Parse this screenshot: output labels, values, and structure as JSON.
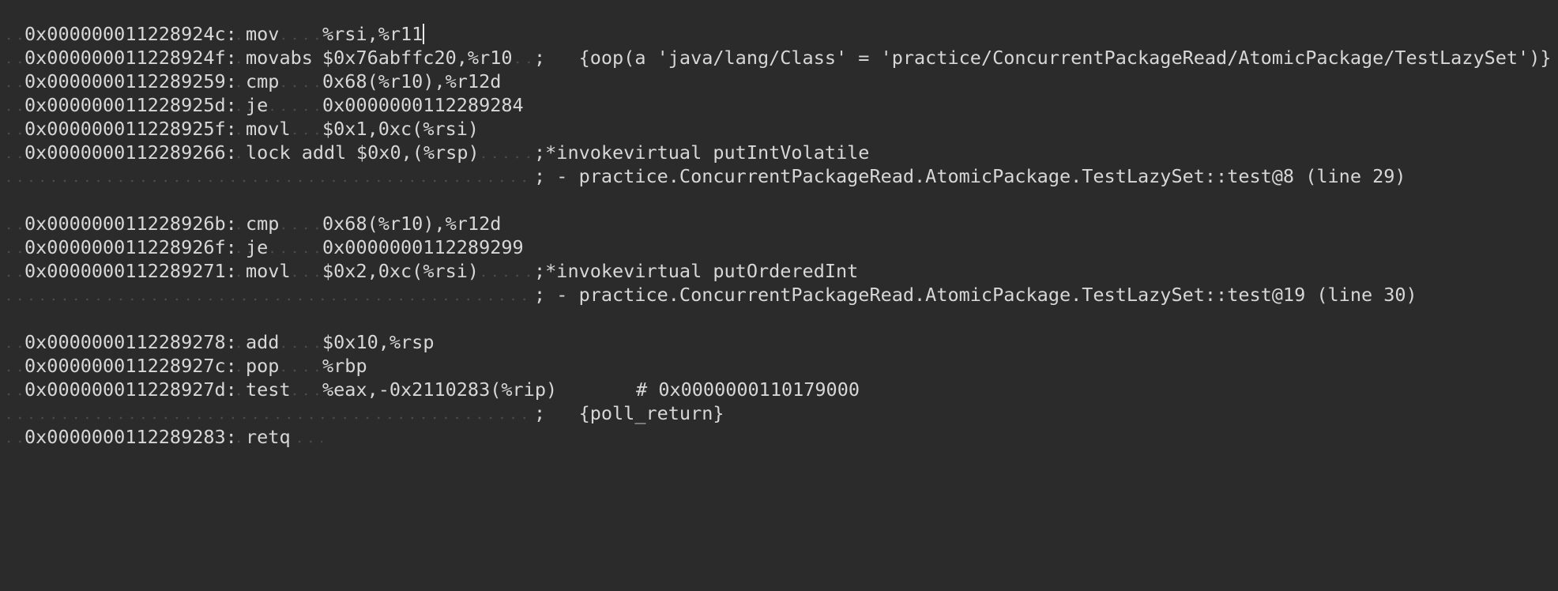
{
  "editor": {
    "colors": {
      "background": "#2b2b2b",
      "text": "#d7d7d7",
      "whitespace_marker": "#5a5a5a",
      "caret": "#e8e8e8"
    },
    "lines": [
      {
        "addr": "0x000000011228924c:",
        "op": "mov",
        "args": "%rsi,%r11",
        "comment": ""
      },
      {
        "addr": "0x000000011228924f:",
        "op": "movabs",
        "args": "$0x76abffc20,%r10",
        "comment": ";   {oop(a 'java/lang/Class' = 'practice/ConcurrentPackageRead/AtomicPackage/TestLazySet')}"
      },
      {
        "addr": "0x0000000112289259:",
        "op": "cmp",
        "args": "0x68(%r10),%r12d",
        "comment": ""
      },
      {
        "addr": "0x000000011228925d:",
        "op": "je",
        "args": "0x0000000112289284",
        "comment": ""
      },
      {
        "addr": "0x000000011228925f:",
        "op": "movl",
        "args": "$0x1,0xc(%rsi)",
        "comment": ""
      },
      {
        "addr": "0x0000000112289266:",
        "op": "lock addl",
        "args": "$0x0,(%rsp)",
        "comment": ";*invokevirtual putIntVolatile"
      },
      {
        "addr": "",
        "op": "",
        "args": "",
        "comment": "; - practice.ConcurrentPackageRead.AtomicPackage.TestLazySet::test@8 (line 29)"
      },
      {
        "addr": "",
        "op": "",
        "args": "",
        "comment": ""
      },
      {
        "addr": "0x000000011228926b:",
        "op": "cmp",
        "args": "0x68(%r10),%r12d",
        "comment": ""
      },
      {
        "addr": "0x000000011228926f:",
        "op": "je",
        "args": "0x0000000112289299",
        "comment": ""
      },
      {
        "addr": "0x0000000112289271:",
        "op": "movl",
        "args": "$0x2,0xc(%rsi)",
        "comment": ";*invokevirtual putOrderedInt"
      },
      {
        "addr": "",
        "op": "",
        "args": "",
        "comment": "; - practice.ConcurrentPackageRead.AtomicPackage.TestLazySet::test@19 (line 30)"
      },
      {
        "addr": "",
        "op": "",
        "args": "",
        "comment": ""
      },
      {
        "addr": "0x0000000112289278:",
        "op": "add",
        "args": "$0x10,%rsp",
        "comment": ""
      },
      {
        "addr": "0x000000011228927c:",
        "op": "pop",
        "args": "%rbp",
        "comment": ""
      },
      {
        "addr": "0x000000011228927d:",
        "op": "test",
        "args": "%eax,-0x2110283(%rip)",
        "comment": "       # 0x0000000110179000"
      },
      {
        "addr": "",
        "op": "",
        "args": "",
        "comment": ";   {poll_return}"
      },
      {
        "addr": "0x0000000112289283:",
        "op": "retq",
        "args": "",
        "comment": ""
      }
    ]
  }
}
